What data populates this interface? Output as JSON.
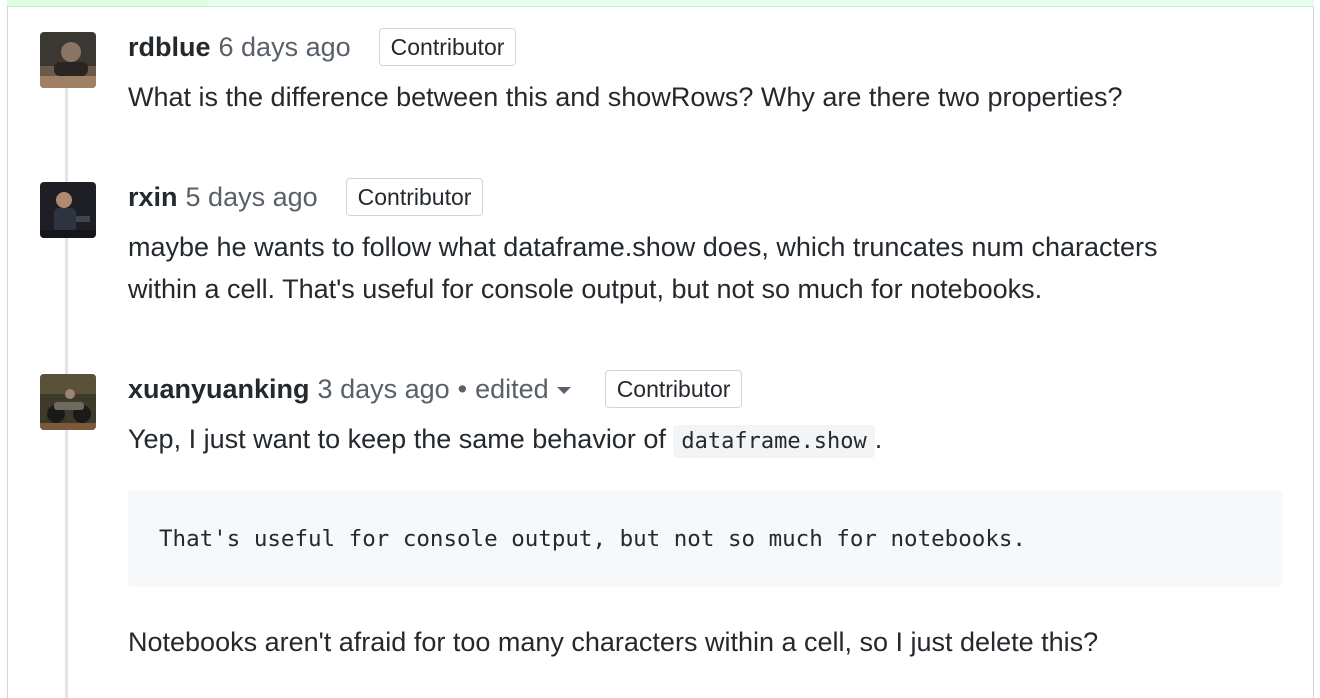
{
  "comments": [
    {
      "author": "rdblue",
      "time": "6 days ago",
      "badge": "Contributor",
      "text": "What is the difference between this and showRows? Why are there two properties?"
    },
    {
      "author": "rxin",
      "time": "5 days ago",
      "badge": "Contributor",
      "text_line1": "maybe he wants to follow what dataframe.show does, which truncates num characters",
      "text_line2": "within a cell. That's useful for console output, but not so much for notebooks."
    },
    {
      "author": "xuanyuanking",
      "time": "3 days ago",
      "separator": "•",
      "edited": "edited",
      "badge": "Contributor",
      "text_prefix": "Yep, I just want to keep the same behavior of",
      "inline_code": "dataframe.show",
      "text_suffix": ".",
      "quote_code": "That's useful for console output, but not so much for notebooks.",
      "text_after": "Notebooks aren't afraid for too many characters within a cell, so I just delete this?"
    }
  ],
  "icons": {
    "edited_menu": "chevron-down-icon",
    "avatar": "avatar-image"
  }
}
